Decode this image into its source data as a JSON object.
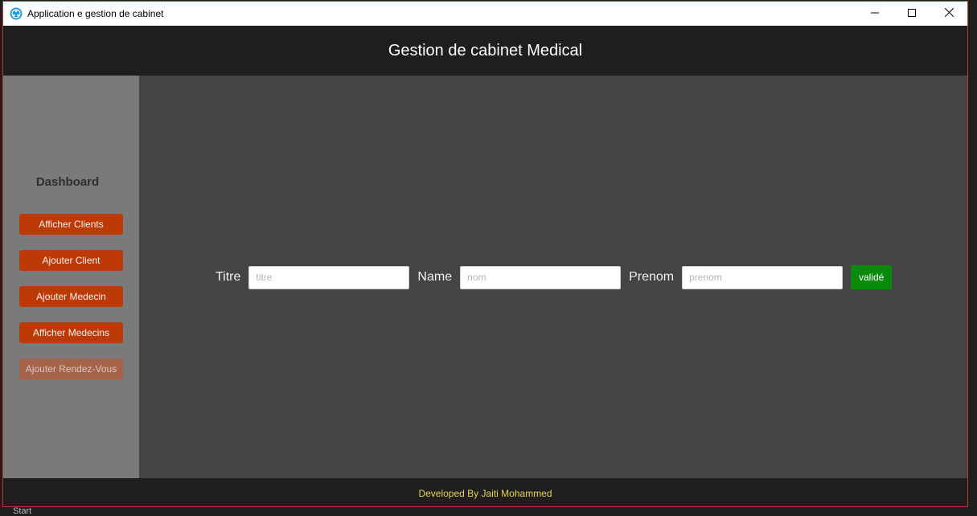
{
  "window": {
    "title": "Application e gestion de cabinet",
    "icon": "app-logo-icon",
    "controls": [
      "minimize-icon",
      "maximize-icon",
      "close-icon"
    ]
  },
  "header": {
    "title": "Gestion de cabinet Medical"
  },
  "sidebar": {
    "heading": "Dashboard",
    "items": [
      {
        "label": "Afficher Clients",
        "enabled": true
      },
      {
        "label": "Ajouter Client",
        "enabled": true
      },
      {
        "label": "Ajouter Medecin",
        "enabled": true
      },
      {
        "label": "Afficher Medecins",
        "enabled": true
      },
      {
        "label": "Ajouter Rendez-Vous",
        "enabled": false
      }
    ]
  },
  "form": {
    "titre_label": "Titre",
    "titre_placeholder": "titre",
    "titre_value": "",
    "name_label": "Name",
    "name_placeholder": "nom",
    "name_value": "",
    "prenom_label": "Prenom",
    "prenom_placeholder": "prenom",
    "prenom_value": "",
    "submit_label": "validé"
  },
  "footer": {
    "text": "Developed By Jaiti Mohammed"
  },
  "colors": {
    "accent_button": "#bd3a06",
    "submit_button": "#0a8a0a",
    "footer_text": "#e6d44a"
  },
  "taskbar": {
    "start_label": "Start"
  }
}
